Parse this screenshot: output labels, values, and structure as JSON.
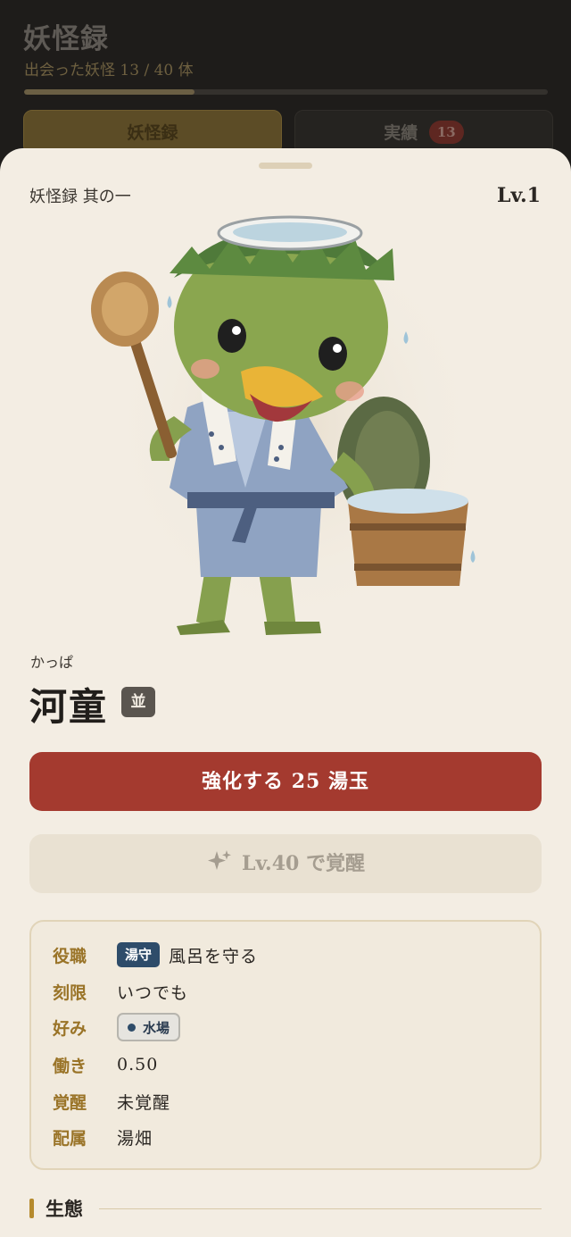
{
  "background": {
    "title": "妖怪録",
    "subtitle": "出会った妖怪 13 / 40 体",
    "progress_fraction": 0.325,
    "tabs": [
      {
        "label": "妖怪録",
        "active": true
      },
      {
        "label": "実績",
        "badge": "13",
        "active": false
      }
    ]
  },
  "sheet": {
    "series": "妖怪録 其の一",
    "level": "Lv.1",
    "reading": "かっぱ",
    "name": "河童",
    "rarity": "並",
    "enhance_button": "強化する 25 湯玉",
    "awaken_button": "Lv.40 で覚醒",
    "info": {
      "role": {
        "key": "役職",
        "tag": "湯守",
        "value": "風呂を守る"
      },
      "time": {
        "key": "刻限",
        "value": "いつでも"
      },
      "preference": {
        "key": "好み",
        "tag": "水場"
      },
      "work": {
        "key": "働き",
        "value": "0.50"
      },
      "awakening": {
        "key": "覚醒",
        "value": "未覚醒"
      },
      "assignment": {
        "key": "配属",
        "value": "湯畑"
      }
    },
    "section_title": "生態"
  },
  "colors": {
    "accent_red": "#a43a2f",
    "gold": "#9a7428",
    "sheet_bg": "#f3ede3",
    "role_tag": "#2e4c6a"
  },
  "icons": {
    "awaken": "sparkle-icon",
    "preference_dot": "dot-icon"
  }
}
